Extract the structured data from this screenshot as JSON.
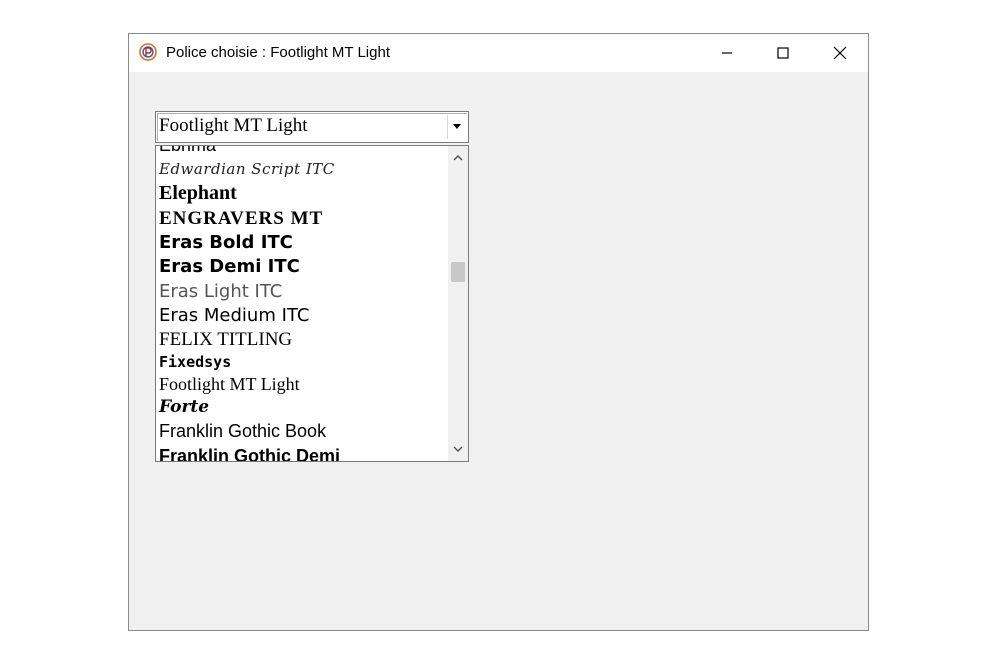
{
  "window": {
    "title": "Police choisie : Footlight MT Light",
    "icon": "java-app-icon",
    "controls": [
      "minimize-icon",
      "maximize-icon",
      "close-icon"
    ]
  },
  "combo": {
    "value": "Footlight MT Light"
  },
  "font_list": {
    "items": [
      "Ebrima",
      "Edwardian Script ITC",
      "Elephant",
      "ENGRAVERS MT",
      "Eras Bold ITC",
      "Eras Demi ITC",
      "Eras Light ITC",
      "Eras Medium ITC",
      "FELIX TITLING",
      "Fixedsys",
      "Footlight MT Light",
      "Forte",
      "Franklin Gothic Book",
      "Franklin Gothic Demi"
    ]
  }
}
